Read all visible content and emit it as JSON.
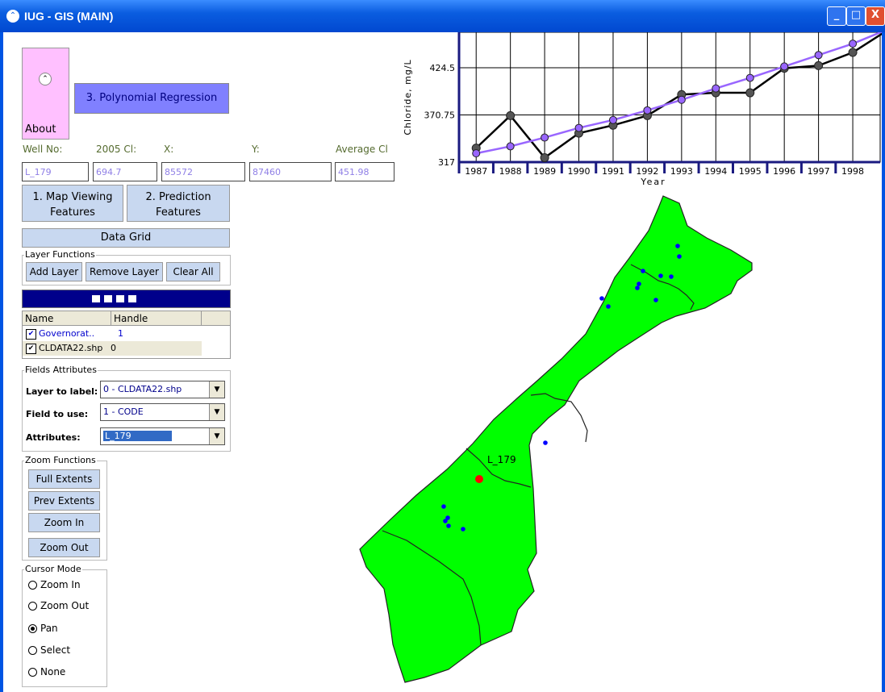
{
  "window": {
    "title": "IUG - GIS (MAIN)",
    "minimize": "_",
    "maximize": "□",
    "close": "X"
  },
  "about": {
    "label": "About",
    "chevron": "⌃"
  },
  "poly_button": "3. Polynomial Regression",
  "info": {
    "labels": [
      "Well No:",
      "2005 Cl:",
      "X:",
      "Y:",
      "Average Cl"
    ],
    "values": [
      "L_179",
      "694.7",
      "85572",
      "87460",
      "451.98"
    ]
  },
  "buttons": {
    "map_viewing": "1. Map Viewing Features",
    "prediction": "2. Prediction Features",
    "data_grid": "Data Grid"
  },
  "layer_functions": {
    "title": "Layer Functions",
    "add": "Add Layer",
    "remove": "Remove Layer",
    "clear": "Clear All"
  },
  "layer_grid": {
    "headers": [
      "Name",
      "Handle"
    ],
    "rows": [
      {
        "name": "Governorat..",
        "handle": "1"
      },
      {
        "name": "CLDATA22.shp",
        "handle": "0"
      }
    ]
  },
  "fields": {
    "title": "Fields Attributes",
    "layer_label": "Layer to label:",
    "layer_value": "0 - CLDATA22.shp",
    "field_label": "Field to use:",
    "field_value": "1 - CODE",
    "attr_label": "Attributes:",
    "attr_value": "L_179"
  },
  "zoom": {
    "title": "Zoom Functions",
    "full": "Full Extents",
    "prev": "Prev Extents",
    "in": "Zoom In",
    "out": "Zoom Out"
  },
  "cursor": {
    "title": "Cursor Mode",
    "options": [
      "Zoom In",
      "Zoom Out",
      "Pan",
      "Select",
      "None"
    ],
    "selected": "Pan"
  },
  "map": {
    "label": "L_179"
  },
  "colors": {
    "accent": "#0054e3",
    "map_fill": "#00ff00",
    "measured": "#000000",
    "fitted": "#9966ff",
    "well_dot": "#0000ff",
    "selected_well": "#ff0000"
  },
  "chart_data": {
    "type": "line",
    "xlabel": "Year",
    "ylabel": "Chloride, mg/L",
    "yticks": [
      317,
      370.75,
      424.5
    ],
    "ylim": [
      317,
      465
    ],
    "x": [
      1987,
      1988,
      1989,
      1990,
      1991,
      1992,
      1993,
      1994,
      1995,
      1996,
      1997,
      1998
    ],
    "xlim": [
      1986.5,
      1998.8
    ],
    "series": [
      {
        "values": [
          333,
          370,
          322,
          350,
          359,
          370,
          394,
          396,
          396,
          424,
          427,
          442,
          467
        ]
      },
      {
        "values": [
          327,
          335,
          345,
          356,
          365,
          376,
          388,
          401,
          413,
          426,
          439,
          452,
          468
        ]
      }
    ]
  }
}
